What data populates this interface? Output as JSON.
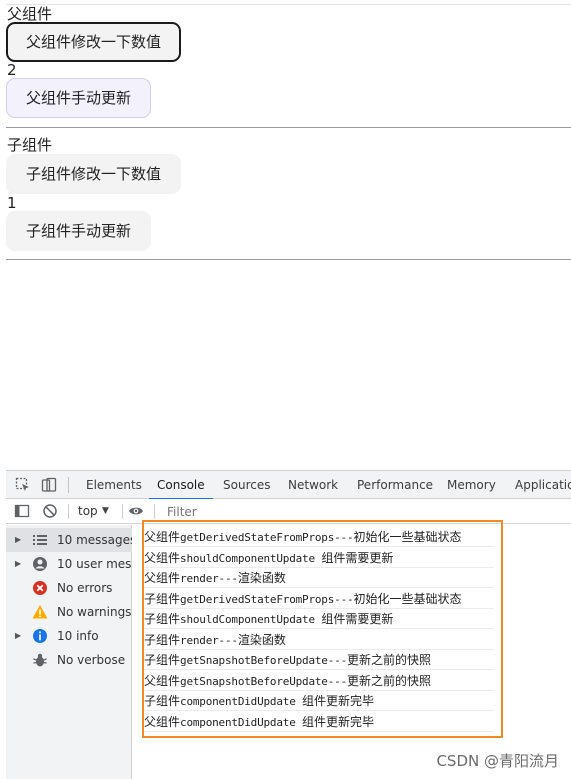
{
  "parent": {
    "heading": "父组件",
    "modify_button": "父组件修改一下数值",
    "value": "2",
    "update_button": "父组件手动更新"
  },
  "child": {
    "heading": "子组件",
    "modify_button": "子组件修改一下数值",
    "value": "1",
    "update_button": "子组件手动更新"
  },
  "devtools": {
    "tabs": [
      "Elements",
      "Console",
      "Sources",
      "Network",
      "Performance",
      "Memory",
      "Application"
    ],
    "active_tab": "Console",
    "context": "top",
    "filter_placeholder": "Filter",
    "sidebar": [
      {
        "label": "10 messages",
        "icon": "list-icon",
        "color": "#5f6368"
      },
      {
        "label": "10 user mes...",
        "icon": "user-icon",
        "color": "#5f6368"
      },
      {
        "label": "No errors",
        "icon": "error-icon",
        "color": "#d93025"
      },
      {
        "label": "No warnings",
        "icon": "warning-icon",
        "color": "#f9ab00"
      },
      {
        "label": "10 info",
        "icon": "info-icon",
        "color": "#1a73e8"
      },
      {
        "label": "No verbose",
        "icon": "bug-icon",
        "color": "#5f6368"
      }
    ],
    "logs": [
      {
        "a": "父组件",
        "b": "getDerivedStateFromProps---",
        "c": "初始化一些基础状态"
      },
      {
        "a": "父组件",
        "b": "shouldComponentUpdate ",
        "c": "组件需要更新"
      },
      {
        "a": "父组件",
        "b": "render---",
        "c": "渲染函数"
      },
      {
        "a": "子组件",
        "b": "getDerivedStateFromProps---",
        "c": "初始化一些基础状态"
      },
      {
        "a": "子组件",
        "b": "shouldComponentUpdate ",
        "c": "组件需要更新"
      },
      {
        "a": "子组件",
        "b": "render---",
        "c": "渲染函数"
      },
      {
        "a": "子组件",
        "b": "getSnapshotBeforeUpdate---",
        "c": "更新之前的快照"
      },
      {
        "a": "父组件",
        "b": "getSnapshotBeforeUpdate---",
        "c": "更新之前的快照"
      },
      {
        "a": "子组件",
        "b": "componentDidUpdate ",
        "c": "组件更新完毕"
      },
      {
        "a": "父组件",
        "b": "componentDidUpdate ",
        "c": "组件更新完毕"
      }
    ],
    "highlight_color": "#f08a24"
  },
  "watermark": "CSDN @青阳流月"
}
